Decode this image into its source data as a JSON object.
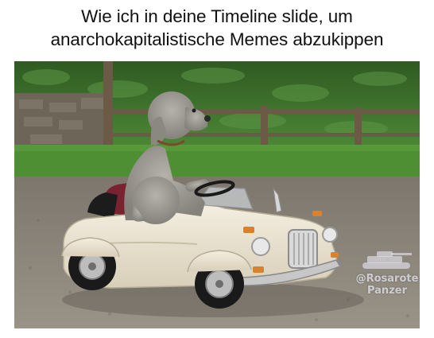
{
  "caption": {
    "line1": "Wie ich in deine Timeline slide, um",
    "line2": "anarchokapitalistische Memes abzukippen"
  },
  "watermark": {
    "line1": "@Rosarote",
    "line2": "Panzer"
  },
  "colors": {
    "text": "#111111",
    "background": "#ffffff",
    "hedge": "#3f6e2f",
    "lawn": "#4e8f33",
    "road": "#8a8378",
    "car_body": "#ebe4d2",
    "dog_fur": "#a09d97"
  }
}
